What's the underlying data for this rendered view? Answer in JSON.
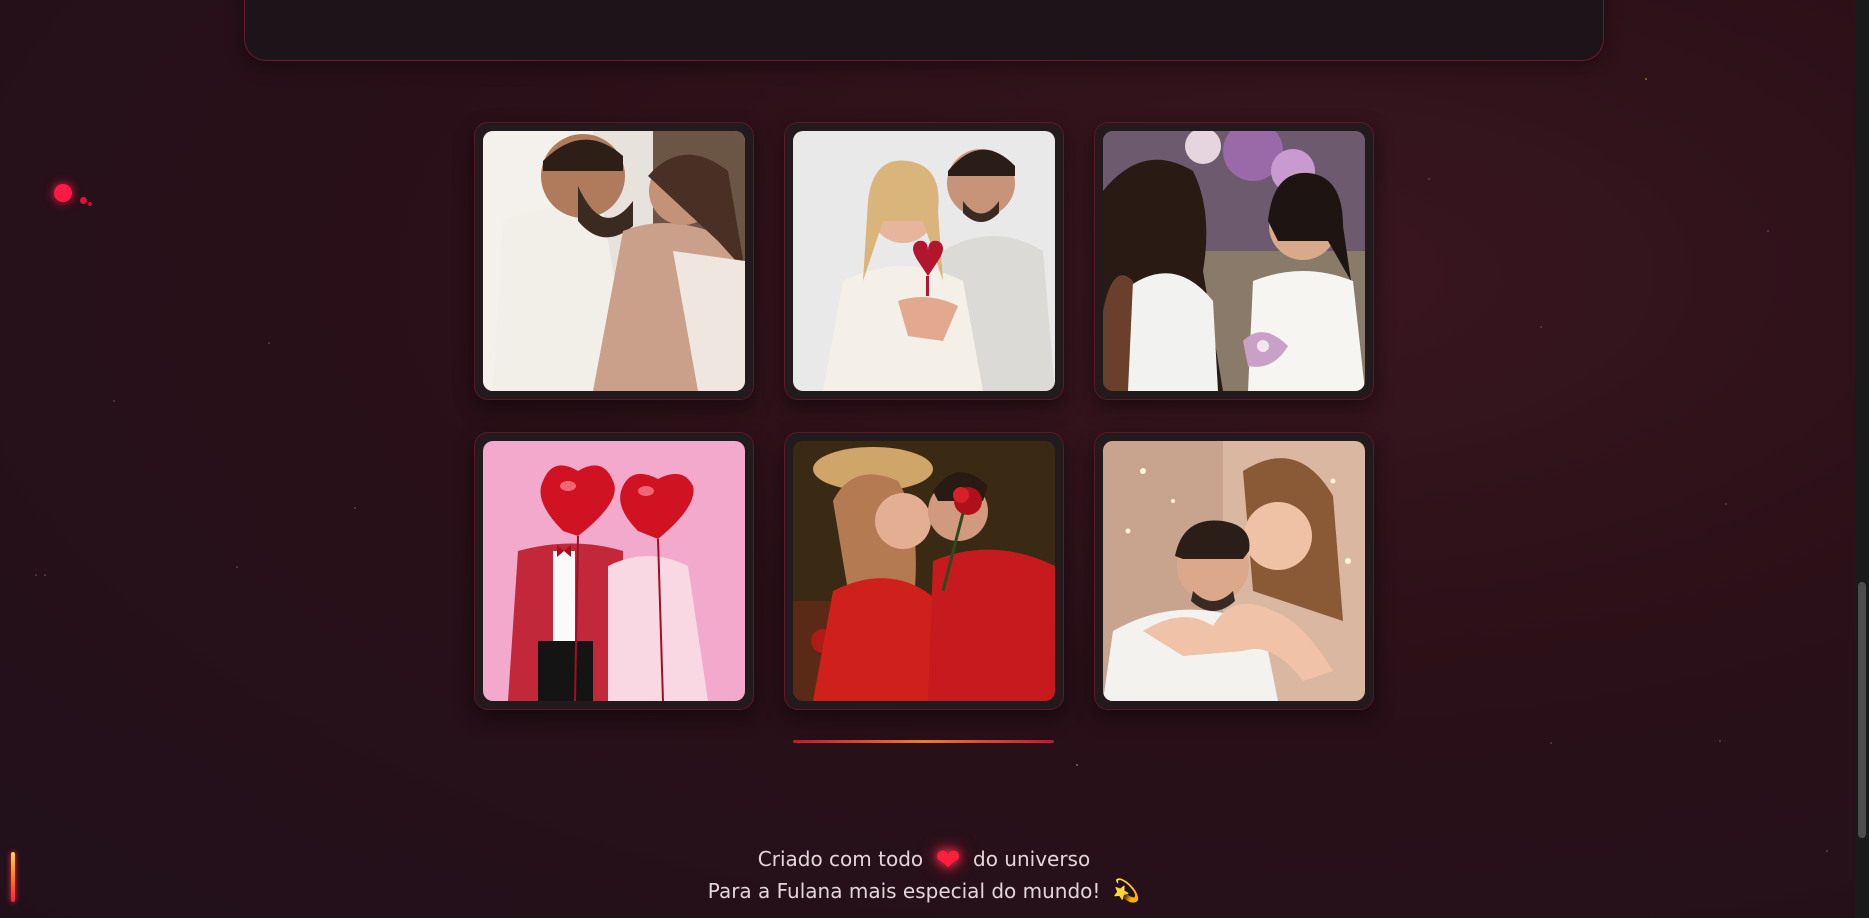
{
  "gallery": {
    "photos": [
      {
        "alt": "Casal abraçado sorrindo"
      },
      {
        "alt": "Casal com coração de papel"
      },
      {
        "alt": "Noivas em cerimônia"
      },
      {
        "alt": "Casal com balões de coração"
      },
      {
        "alt": "Casal com rosa vermelha"
      },
      {
        "alt": "Casal abraçado com luzes"
      }
    ]
  },
  "footer": {
    "line1_before": "Criado com todo",
    "line1_heart": "❤",
    "line1_after": "do universo",
    "line2": "Para a Fulana mais especial do mundo!",
    "line2_emoji": "💫"
  },
  "colors": {
    "accent": "#ff1f3d",
    "card_border": "#5e1628",
    "background": "#2a1018"
  }
}
